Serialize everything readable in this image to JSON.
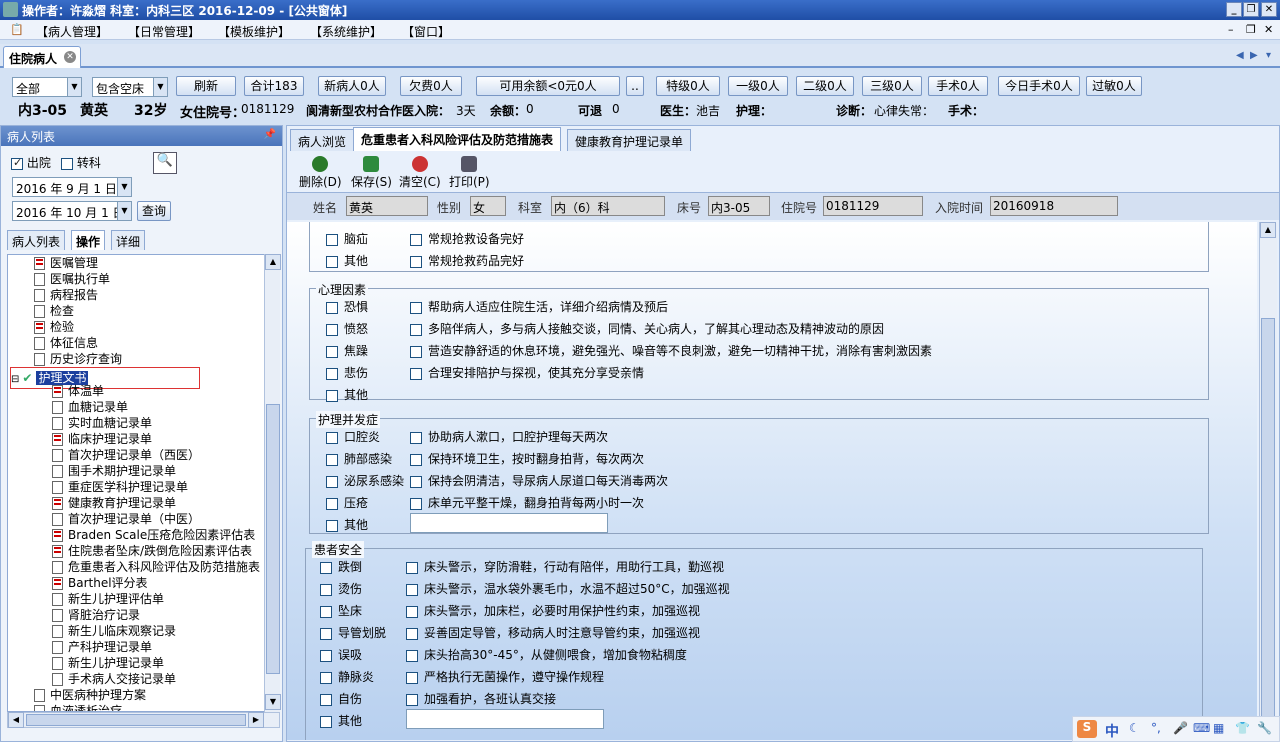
{
  "window": {
    "title": "操作者：许淼熠 科室：内科三区 2016-12-09 - [公共窗体]"
  },
  "menu": [
    "【病人管理】",
    "【日常管理】",
    "【模板维护】",
    "【系统维护】",
    "【窗口】"
  ],
  "main_tab": "住院病人",
  "toolbar": {
    "filter1": "全部",
    "filter2": "包含空床",
    "buttons": [
      "刷新",
      "合计183",
      "新病人0人",
      "欠费0人",
      "可用余额<0元0人",
      "..",
      "特级0人",
      "一级0人",
      "二级0人",
      "三级0人",
      "手术0人",
      "今日手术0人",
      "过敏0人"
    ]
  },
  "patient_info": {
    "bed": "内3-05",
    "name": "黄英",
    "age": "32岁",
    "gender_id_label": "女住院号：",
    "id": "0181129",
    "insurance": "阆清新型农村合作医入院：",
    "days": "3天",
    "balance_label": "余额：",
    "balance": "0",
    "refund_label": "可退",
    "refund": "0",
    "doctor_label": "医生：",
    "doctor": "池吉",
    "nursing_label": "护理：",
    "diagnosis_label": "诊断：",
    "diagnosis": "心律失常：",
    "surgery_label": "手术："
  },
  "left": {
    "header": "病人列表",
    "discharged": "出院",
    "transfer": "转科",
    "date_from": "2016 年 9 月 1 日",
    "date_to": "2016 年 10 月 1 日",
    "query": "查询",
    "tabs": [
      "病人列表",
      "操作",
      "详细"
    ],
    "tree": [
      "医嘱管理",
      "医嘱执行单",
      "病程报告",
      "检查",
      "检验",
      "体征信息",
      "历史诊疗查询",
      "护理文书",
      "体温单",
      "血糖记录单",
      "实时血糖记录单",
      "临床护理记录单",
      "首次护理记录单（西医）",
      "围手术期护理记录单",
      "重症医学科护理记录单",
      "健康教育护理记录单",
      "首次护理记录单（中医）",
      "Braden Scale压疮危险因素评估表",
      "住院患者坠床/跌倒危险因素评估表",
      "危重患者入科风险评估及防范措施表",
      "Barthel评分表",
      "新生儿护理评估单",
      "肾脏治疗记录",
      "新生儿临床观察记录",
      "产科护理记录单",
      "新生儿护理记录单",
      "手术病人交接记录单",
      "中医病种护理方案",
      "血液透析治疗"
    ]
  },
  "right": {
    "tabs": [
      "病人浏览",
      "危重患者入科风险评估及防范措施表",
      "健康教育护理记录单"
    ],
    "actions": [
      "删除(D)",
      "保存(S)",
      "清空(C)",
      "打印(P)"
    ],
    "header": {
      "name_label": "姓名",
      "name": "黄英",
      "gender_label": "性别",
      "gender": "女",
      "dept_label": "科室",
      "dept": "内（6）科",
      "bed_label": "床号",
      "bed": "内3-05",
      "id_label": "住院号",
      "id": "0181129",
      "admit_label": "入院时间",
      "admit": "20160918"
    },
    "top_partial": {
      "rows": [
        {
          "risk": "脑疝",
          "measure": "常规抢救设备完好"
        },
        {
          "risk": "其他",
          "measure": "常规抢救药品完好"
        }
      ]
    },
    "psych": {
      "title": "心理因素",
      "rows": [
        {
          "risk": "恐惧",
          "measure": "帮助病人适应住院生活，详细介绍病情及预后"
        },
        {
          "risk": "愤怒",
          "measure": "多陪伴病人，多与病人接触交谈，同情、关心病人，了解其心理动态及精神波动的原因"
        },
        {
          "risk": "焦躁",
          "measure": "营造安静舒适的休息环境，避免强光、噪音等不良刺激，避免一切精神干扰，消除有害刺激因素"
        },
        {
          "risk": "悲伤",
          "measure": "合理安排陪护与探视，使其充分享受亲情"
        },
        {
          "risk": "其他",
          "measure": ""
        }
      ]
    },
    "complication": {
      "title": "护理并发症",
      "rows": [
        {
          "risk": "口腔炎",
          "measure": "协助病人漱口，口腔护理每天两次"
        },
        {
          "risk": "肺部感染",
          "measure": "保持环境卫生，按时翻身拍背，每次两次"
        },
        {
          "risk": "泌尿系感染",
          "measure": "保持会阴清洁，导尿病人尿道口每天消毒两次"
        },
        {
          "risk": "压疮",
          "measure": "床单元平整干燥，翻身拍背每两小时一次"
        },
        {
          "risk": "其他",
          "measure": ""
        }
      ]
    },
    "safety": {
      "title": "患者安全",
      "rows": [
        {
          "risk": "跌倒",
          "measure": "床头警示，穿防滑鞋，行动有陪伴，用助行工具，勤巡视"
        },
        {
          "risk": "烫伤",
          "measure": "床头警示，温水袋外裹毛巾，水温不超过50°C，加强巡视"
        },
        {
          "risk": "坠床",
          "measure": "床头警示，加床栏，必要时用保护性约束，加强巡视"
        },
        {
          "risk": "导管划脱",
          "measure": "妥善固定导管，移动病人时注意导管约束，加强巡视"
        },
        {
          "risk": "误吸",
          "measure": "床头抬高30°-45°，从健侧喂食，增加食物粘稠度"
        },
        {
          "risk": "静脉炎",
          "measure": "严格执行无菌操作，遵守操作规程"
        },
        {
          "risk": "自伤",
          "measure": "加强看护，各班认真交接"
        },
        {
          "risk": "其他",
          "measure": ""
        }
      ]
    }
  },
  "tray": [
    "中"
  ]
}
